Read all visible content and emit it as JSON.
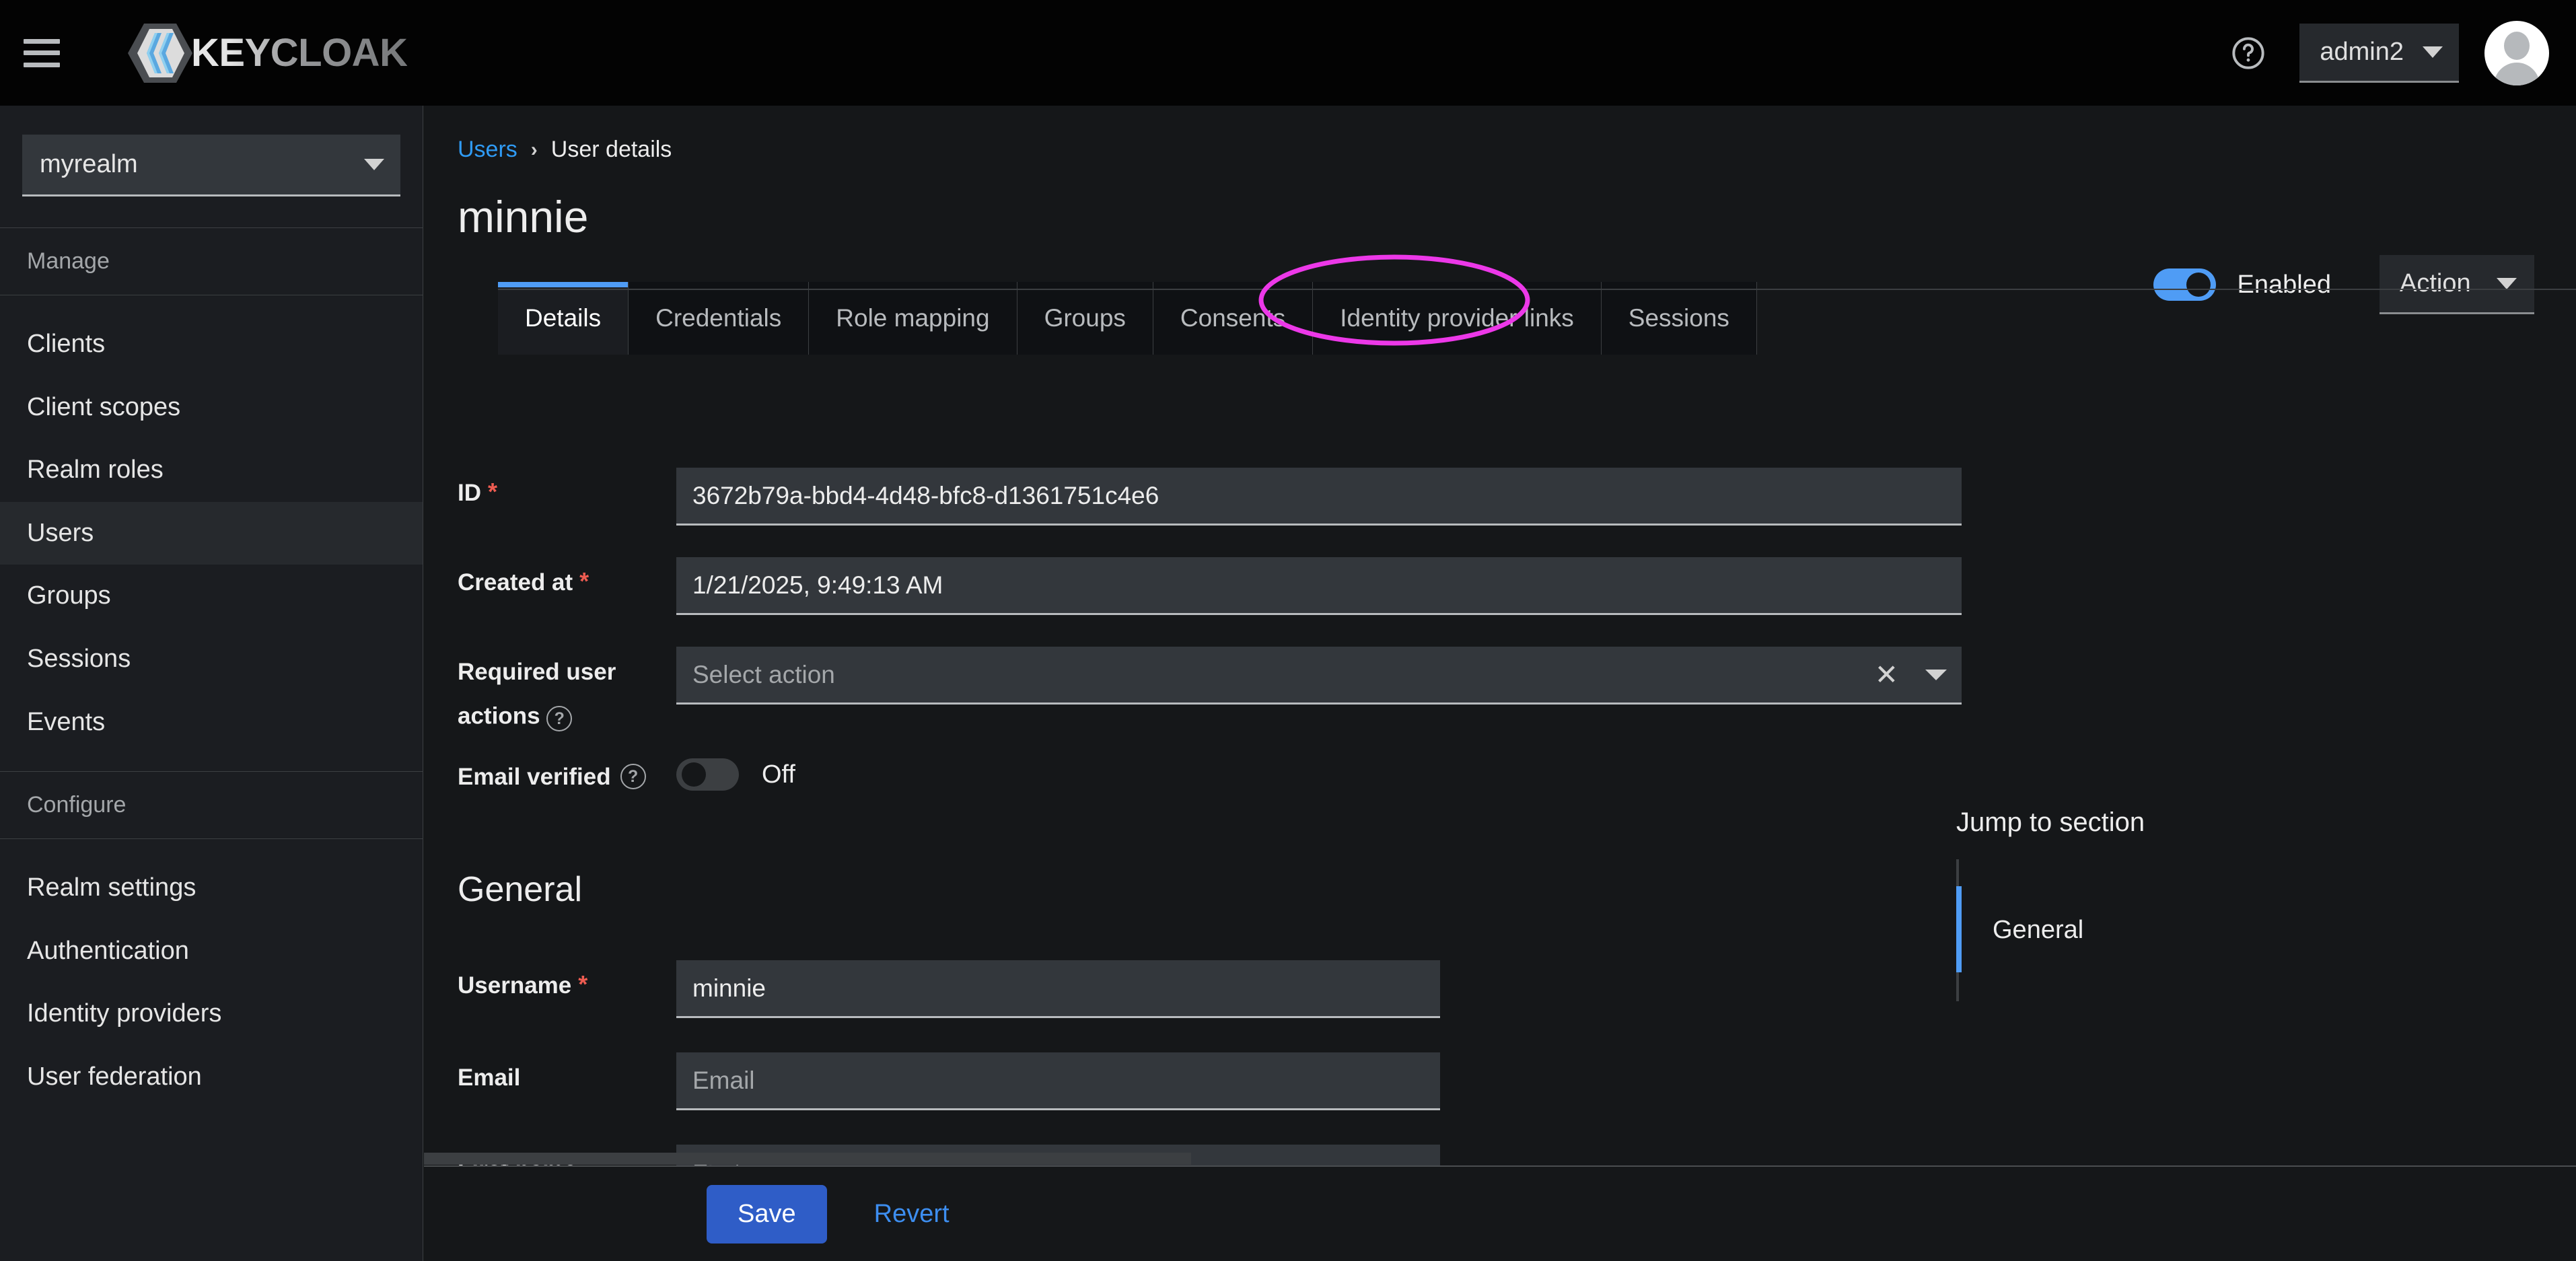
{
  "masthead": {
    "menu_icon": "hamburger-icon",
    "brand_name": "KEYCLOAK",
    "help_icon": "help-circle-icon",
    "user_name": "admin2",
    "avatar_icon": "user-avatar-icon"
  },
  "sidebar": {
    "realm_selected": "myrealm",
    "sections": [
      {
        "label": "Manage",
        "items": [
          {
            "label": "Clients",
            "active": false
          },
          {
            "label": "Client scopes",
            "active": false
          },
          {
            "label": "Realm roles",
            "active": false
          },
          {
            "label": "Users",
            "active": true
          },
          {
            "label": "Groups",
            "active": false
          },
          {
            "label": "Sessions",
            "active": false
          },
          {
            "label": "Events",
            "active": false
          }
        ]
      },
      {
        "label": "Configure",
        "items": [
          {
            "label": "Realm settings",
            "active": false
          },
          {
            "label": "Authentication",
            "active": false
          },
          {
            "label": "Identity providers",
            "active": false
          },
          {
            "label": "User federation",
            "active": false
          }
        ]
      }
    ]
  },
  "breadcrumb": {
    "parent": "Users",
    "separator": "›",
    "current": "User details"
  },
  "page": {
    "title": "minnie",
    "enabled_label": "Enabled",
    "enabled_state": "on",
    "action_label": "Action"
  },
  "tabs": [
    {
      "label": "Details",
      "active": true
    },
    {
      "label": "Credentials",
      "active": false
    },
    {
      "label": "Role mapping",
      "active": false
    },
    {
      "label": "Groups",
      "active": false
    },
    {
      "label": "Consents",
      "active": false
    },
    {
      "label": "Identity provider links",
      "active": false
    },
    {
      "label": "Sessions",
      "active": false
    }
  ],
  "form": {
    "id": {
      "label": "ID",
      "required": "*",
      "value": "3672b79a-bbd4-4d48-bfc8-d1361751c4e6"
    },
    "created_at": {
      "label": "Created at",
      "required": "*",
      "value": "1/21/2025, 9:49:13 AM"
    },
    "required_user_actions": {
      "label": "Required user actions",
      "placeholder": "Select action",
      "clear_icon": "✕",
      "help_icon": "?"
    },
    "email_verified": {
      "label": "Email verified",
      "help_icon": "?",
      "state_label": "Off",
      "state": "off"
    },
    "general_heading": "General",
    "username": {
      "label": "Username",
      "required": "*",
      "value": "minnie"
    },
    "email": {
      "label": "Email",
      "placeholder": "Email",
      "value": ""
    },
    "first_name": {
      "label": "First name",
      "placeholder": "First name",
      "value": ""
    }
  },
  "jump_to_section": {
    "title": "Jump to section",
    "items": [
      {
        "label": "General",
        "active": true
      }
    ]
  },
  "footer": {
    "save_label": "Save",
    "revert_label": "Revert"
  },
  "annotation": {
    "shape": "ellipse-highlight",
    "target": "Identity provider links",
    "color": "#ec38e8"
  },
  "colors": {
    "accent_blue": "#4f9cf5",
    "link_blue": "#2f9bf5",
    "save_blue": "#2f5dc7",
    "required_red": "#ee5c51",
    "annotation_magenta": "#ec38e8"
  }
}
